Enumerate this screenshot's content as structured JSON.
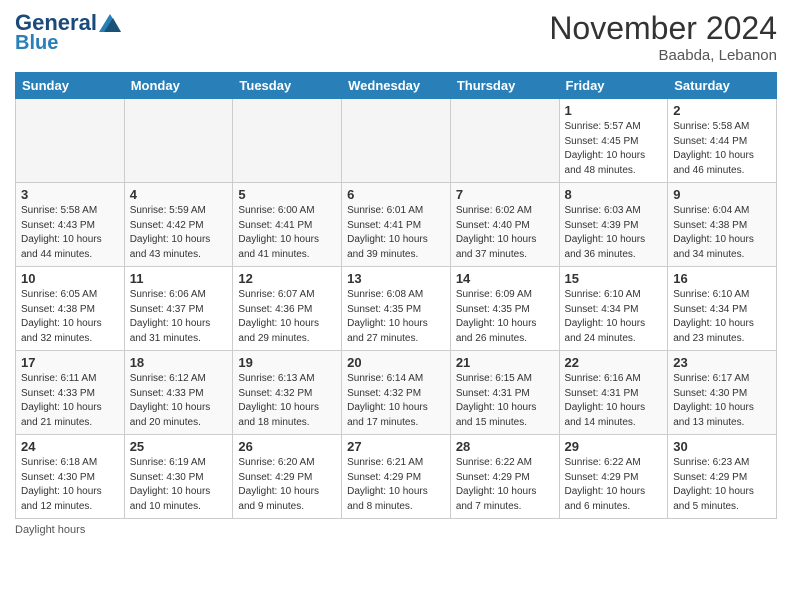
{
  "logo": {
    "line1": "General",
    "line2": "Blue",
    "tagline": ""
  },
  "title": "November 2024",
  "location": "Baabda, Lebanon",
  "days_of_week": [
    "Sunday",
    "Monday",
    "Tuesday",
    "Wednesday",
    "Thursday",
    "Friday",
    "Saturday"
  ],
  "weeks": [
    [
      {
        "day": "",
        "info": ""
      },
      {
        "day": "",
        "info": ""
      },
      {
        "day": "",
        "info": ""
      },
      {
        "day": "",
        "info": ""
      },
      {
        "day": "",
        "info": ""
      },
      {
        "day": "1",
        "info": "Sunrise: 5:57 AM\nSunset: 4:45 PM\nDaylight: 10 hours and 48 minutes."
      },
      {
        "day": "2",
        "info": "Sunrise: 5:58 AM\nSunset: 4:44 PM\nDaylight: 10 hours and 46 minutes."
      }
    ],
    [
      {
        "day": "3",
        "info": "Sunrise: 5:58 AM\nSunset: 4:43 PM\nDaylight: 10 hours and 44 minutes."
      },
      {
        "day": "4",
        "info": "Sunrise: 5:59 AM\nSunset: 4:42 PM\nDaylight: 10 hours and 43 minutes."
      },
      {
        "day": "5",
        "info": "Sunrise: 6:00 AM\nSunset: 4:41 PM\nDaylight: 10 hours and 41 minutes."
      },
      {
        "day": "6",
        "info": "Sunrise: 6:01 AM\nSunset: 4:41 PM\nDaylight: 10 hours and 39 minutes."
      },
      {
        "day": "7",
        "info": "Sunrise: 6:02 AM\nSunset: 4:40 PM\nDaylight: 10 hours and 37 minutes."
      },
      {
        "day": "8",
        "info": "Sunrise: 6:03 AM\nSunset: 4:39 PM\nDaylight: 10 hours and 36 minutes."
      },
      {
        "day": "9",
        "info": "Sunrise: 6:04 AM\nSunset: 4:38 PM\nDaylight: 10 hours and 34 minutes."
      }
    ],
    [
      {
        "day": "10",
        "info": "Sunrise: 6:05 AM\nSunset: 4:38 PM\nDaylight: 10 hours and 32 minutes."
      },
      {
        "day": "11",
        "info": "Sunrise: 6:06 AM\nSunset: 4:37 PM\nDaylight: 10 hours and 31 minutes."
      },
      {
        "day": "12",
        "info": "Sunrise: 6:07 AM\nSunset: 4:36 PM\nDaylight: 10 hours and 29 minutes."
      },
      {
        "day": "13",
        "info": "Sunrise: 6:08 AM\nSunset: 4:35 PM\nDaylight: 10 hours and 27 minutes."
      },
      {
        "day": "14",
        "info": "Sunrise: 6:09 AM\nSunset: 4:35 PM\nDaylight: 10 hours and 26 minutes."
      },
      {
        "day": "15",
        "info": "Sunrise: 6:10 AM\nSunset: 4:34 PM\nDaylight: 10 hours and 24 minutes."
      },
      {
        "day": "16",
        "info": "Sunrise: 6:10 AM\nSunset: 4:34 PM\nDaylight: 10 hours and 23 minutes."
      }
    ],
    [
      {
        "day": "17",
        "info": "Sunrise: 6:11 AM\nSunset: 4:33 PM\nDaylight: 10 hours and 21 minutes."
      },
      {
        "day": "18",
        "info": "Sunrise: 6:12 AM\nSunset: 4:33 PM\nDaylight: 10 hours and 20 minutes."
      },
      {
        "day": "19",
        "info": "Sunrise: 6:13 AM\nSunset: 4:32 PM\nDaylight: 10 hours and 18 minutes."
      },
      {
        "day": "20",
        "info": "Sunrise: 6:14 AM\nSunset: 4:32 PM\nDaylight: 10 hours and 17 minutes."
      },
      {
        "day": "21",
        "info": "Sunrise: 6:15 AM\nSunset: 4:31 PM\nDaylight: 10 hours and 15 minutes."
      },
      {
        "day": "22",
        "info": "Sunrise: 6:16 AM\nSunset: 4:31 PM\nDaylight: 10 hours and 14 minutes."
      },
      {
        "day": "23",
        "info": "Sunrise: 6:17 AM\nSunset: 4:30 PM\nDaylight: 10 hours and 13 minutes."
      }
    ],
    [
      {
        "day": "24",
        "info": "Sunrise: 6:18 AM\nSunset: 4:30 PM\nDaylight: 10 hours and 12 minutes."
      },
      {
        "day": "25",
        "info": "Sunrise: 6:19 AM\nSunset: 4:30 PM\nDaylight: 10 hours and 10 minutes."
      },
      {
        "day": "26",
        "info": "Sunrise: 6:20 AM\nSunset: 4:29 PM\nDaylight: 10 hours and 9 minutes."
      },
      {
        "day": "27",
        "info": "Sunrise: 6:21 AM\nSunset: 4:29 PM\nDaylight: 10 hours and 8 minutes."
      },
      {
        "day": "28",
        "info": "Sunrise: 6:22 AM\nSunset: 4:29 PM\nDaylight: 10 hours and 7 minutes."
      },
      {
        "day": "29",
        "info": "Sunrise: 6:22 AM\nSunset: 4:29 PM\nDaylight: 10 hours and 6 minutes."
      },
      {
        "day": "30",
        "info": "Sunrise: 6:23 AM\nSunset: 4:29 PM\nDaylight: 10 hours and 5 minutes."
      }
    ]
  ],
  "footer": "Daylight hours"
}
